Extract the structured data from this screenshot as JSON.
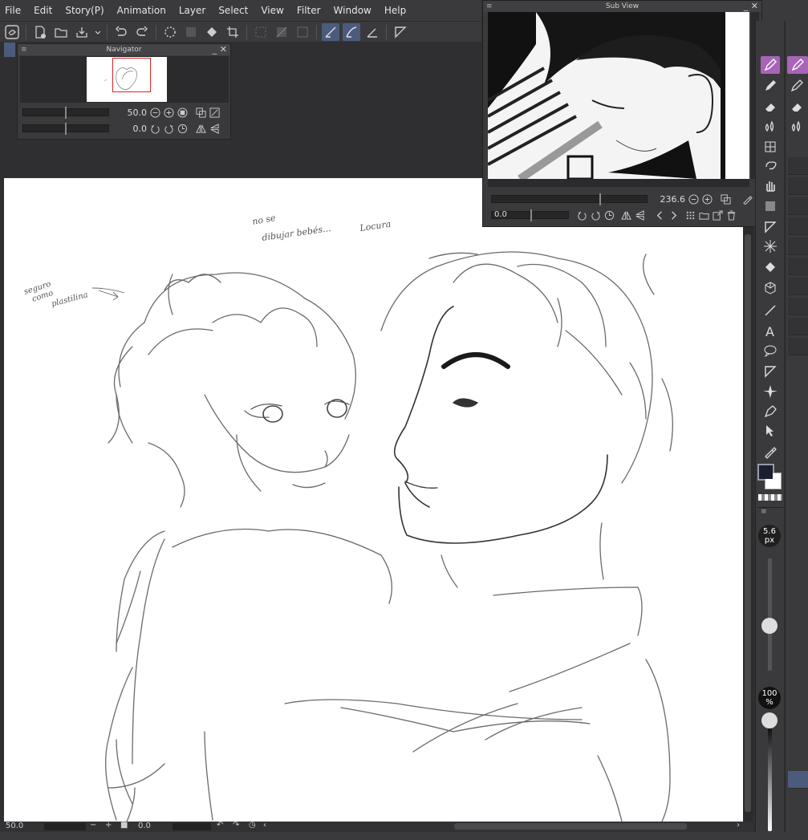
{
  "menu": {
    "items": [
      "File",
      "Edit",
      "Story(P)",
      "Animation",
      "Layer",
      "Select",
      "View",
      "Filter",
      "Window",
      "Help"
    ]
  },
  "navigator": {
    "title": "Navigator",
    "zoom": "50.0",
    "rotation": "0.0",
    "panel_controls": "_ ✕"
  },
  "subview": {
    "title": "Sub View",
    "zoom": "236.6",
    "rotation": "0.0",
    "panel_controls": "_ ✕"
  },
  "status": {
    "zoom": "50.0",
    "rotation": "0.0"
  },
  "tools": {
    "brush_size": "5.6",
    "brush_unit": "px",
    "opacity": "100",
    "opacity_unit": "%"
  },
  "canvas": {
    "note_1_line_1": "no se",
    "note_1_line_2": "dibujar bebés...",
    "note_2": "Locura",
    "note_3_line_1": "seguro",
    "note_3_line_2": "como",
    "note_3_line_3": "plastilina"
  },
  "colors": {
    "ui_bg": "#3a3a3c",
    "ui_dark": "#2f2f31",
    "active_tool": "#a864b8",
    "active_button": "#4b5b7c",
    "nav_frame": "#dd2222",
    "main_color": "#1b2030",
    "sub_color": "#ffffff"
  }
}
